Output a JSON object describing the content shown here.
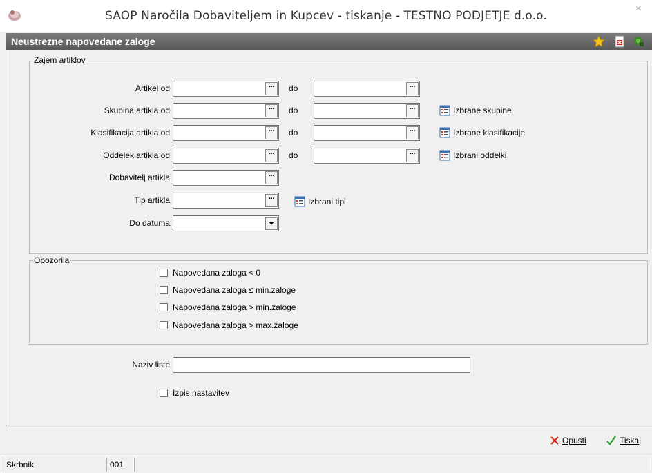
{
  "window": {
    "title": "SAOP   Naročila Dobaviteljem in Kupcev - tiskanje - TESTNO PODJETJE d.o.o.",
    "close_glyph": "×"
  },
  "header": {
    "title": "Neustrezne napovedane zaloge",
    "icons": [
      "star-icon",
      "pdf-export-icon",
      "exit-icon"
    ]
  },
  "zajem": {
    "group_title": "Zajem artiklov",
    "rows": [
      {
        "label": "Artikel od",
        "from_value": "",
        "to_label": "do",
        "to_value": ""
      },
      {
        "label": "Skupina artikla od",
        "from_value": "",
        "to_label": "do",
        "to_value": "",
        "link": "Izbrane skupine"
      },
      {
        "label": "Klasifikacija artikla od",
        "from_value": "",
        "to_label": "do",
        "to_value": "",
        "link": "Izbrane klasifikacije"
      },
      {
        "label": "Oddelek artikla od",
        "from_value": "",
        "to_label": "do",
        "to_value": "",
        "link": "Izbrani oddelki"
      }
    ],
    "dobavitelj_label": "Dobavitelj artikla",
    "dobavitelj_value": "",
    "tip_label": "Tip artikla",
    "tip_value": "",
    "tip_link": "Izbrani tipi",
    "datum_label": "Do datuma",
    "datum_value": "",
    "ellipsis_glyph": "···"
  },
  "opozorila": {
    "group_title": "Opozorila",
    "options": [
      {
        "label": "Napovedana zaloga < 0",
        "checked": false
      },
      {
        "label": "Napovedana zaloga ≤ min.zaloge",
        "checked": false
      },
      {
        "label": "Napovedana zaloga > min.zaloge",
        "checked": false
      },
      {
        "label": "Napovedana zaloga > max.zaloge",
        "checked": false
      }
    ]
  },
  "naziv": {
    "label": "Naziv liste",
    "value": ""
  },
  "izpis": {
    "label": "Izpis nastavitev",
    "checked": false
  },
  "buttons": {
    "cancel_label": "Opusti",
    "print_label": "Tiskaj"
  },
  "status": {
    "user": "Skrbnik",
    "code": "001",
    "extra": ""
  }
}
